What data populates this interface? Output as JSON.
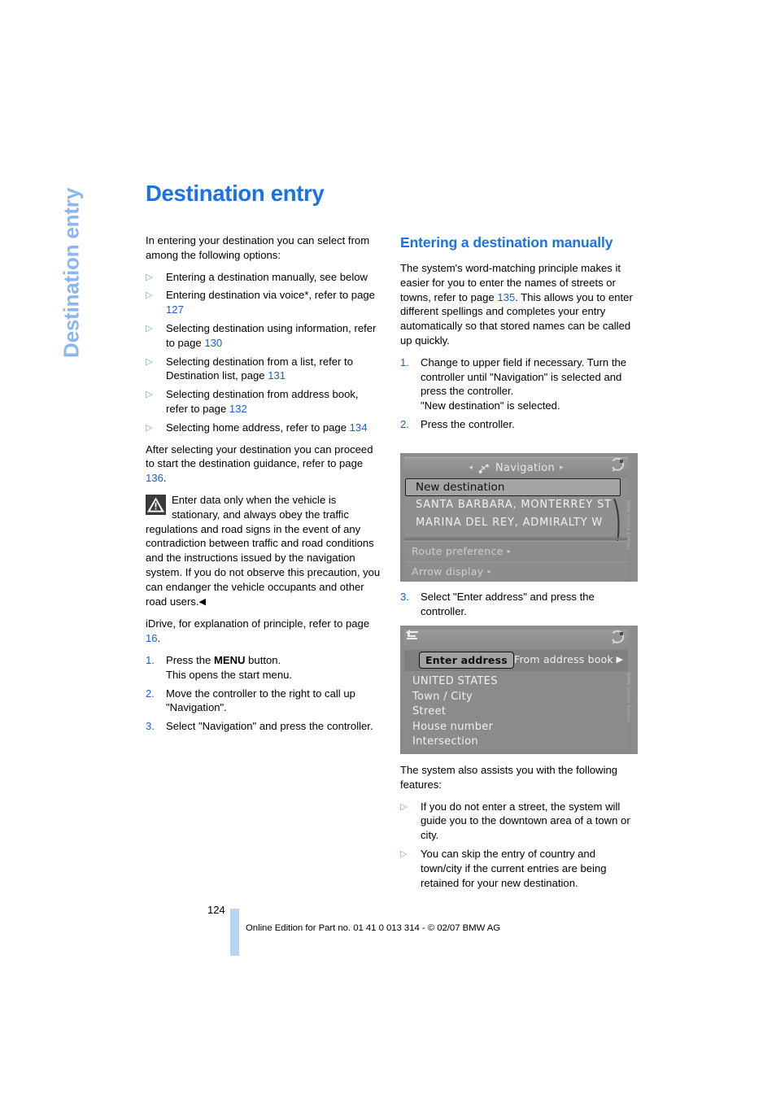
{
  "side_tab": {
    "label": "Destination entry"
  },
  "title": "Destination entry",
  "left_column": {
    "intro": "In entering your destination you can select from among the following options:",
    "options": [
      {
        "text_before": "Entering a destination manually, see below",
        "page": "",
        "text_after": ""
      },
      {
        "text_before": "Entering destination via voice*, refer to page ",
        "page": "127",
        "text_after": ""
      },
      {
        "text_before": "Selecting destination using information, refer to page ",
        "page": "130",
        "text_after": ""
      },
      {
        "text_before": "Selecting destination from a list, refer to Destination list, page ",
        "page": "131",
        "text_after": ""
      },
      {
        "text_before": "Selecting destination from address book, refer to page ",
        "page": "132",
        "text_after": ""
      },
      {
        "text_before": "Selecting home address, refer to page ",
        "page": "134",
        "text_after": ""
      }
    ],
    "after_para_before": "After selecting your destination you can proceed to start the destination guidance, refer to page ",
    "after_para_page": "136",
    "after_para_after": ".",
    "warning": "Enter data only when the vehicle is stationary, and always obey the traffic regulations and road signs in the event of any contradiction between traffic and road conditions and the instructions issued by the navigation system. If you do not observe this precaution, you can endanger the vehicle occupants and other road users.",
    "warning_endmark": "◀",
    "idrive_before": "iDrive, for explanation of principle, refer to page ",
    "idrive_page": "16",
    "idrive_after": ".",
    "steps": [
      {
        "num": "1.",
        "pre": "Press the ",
        "bold": "MENU",
        "post": " button.",
        "sub": "This opens the start menu."
      },
      {
        "num": "2.",
        "pre": "Move the controller to the right to call up \"Navigation\".",
        "bold": "",
        "post": "",
        "sub": ""
      },
      {
        "num": "3.",
        "pre": "Select \"Navigation\" and press the controller.",
        "bold": "",
        "post": "",
        "sub": ""
      }
    ]
  },
  "right_column": {
    "heading": "Entering a destination manually",
    "intro_before": "The system's word-matching principle makes it easier for you to enter the names of streets or towns, refer to page ",
    "intro_page": "135",
    "intro_after": ". This allows you to enter different spellings and completes your entry automatically so that stored names can be called up quickly.",
    "steps_a": [
      {
        "num": "1.",
        "text": "Change to upper field if necessary. Turn the controller until \"Navigation\" is selected and press the controller.",
        "sub": "\"New destination\" is selected."
      },
      {
        "num": "2.",
        "text": "Press the controller.",
        "sub": ""
      }
    ],
    "step_3": {
      "num": "3.",
      "text": "Select \"Enter address\" and press the controller."
    },
    "features_intro": "The system also assists you with the following features:",
    "features": [
      "If you do not enter a street, the system will guide you to the downtown area of a town or city.",
      "You can skip the entry of country and town/city if the current entries are being retained for your new destination."
    ]
  },
  "screenshot_1": {
    "header_title": "Navigation",
    "header_left_arrow": "◂",
    "header_right_arrow": "▸",
    "selected_item": "New destination",
    "list_items": [
      "SANTA BARBARA, MONTERREY ST",
      "MARINA DEL REY, ADMIRALTY W"
    ],
    "menu_rows": [
      {
        "label": "Route preference",
        "caret": "▸"
      },
      {
        "label": "Arrow display",
        "caret": "▸"
      }
    ],
    "watermark": "BMW Online Edition"
  },
  "screenshot_2": {
    "tab_selected": "Enter address",
    "tab_other": "From address book",
    "tab_next_arrow": "▶",
    "list_items": [
      "UNITED STATES",
      "Town / City",
      "Street",
      "House number",
      "Intersection"
    ],
    "watermark": "BMW Online Edition"
  },
  "footer": {
    "page_number": "124",
    "text": "Online Edition for Part no. 01 41 0 013 314 - © 02/07 BMW AG"
  },
  "colors": {
    "accent_blue": "#1a72e8",
    "link_blue": "#1a5ce0",
    "tab_blue": "#8cb6f0",
    "footer_bar": "#b9d3f5"
  }
}
